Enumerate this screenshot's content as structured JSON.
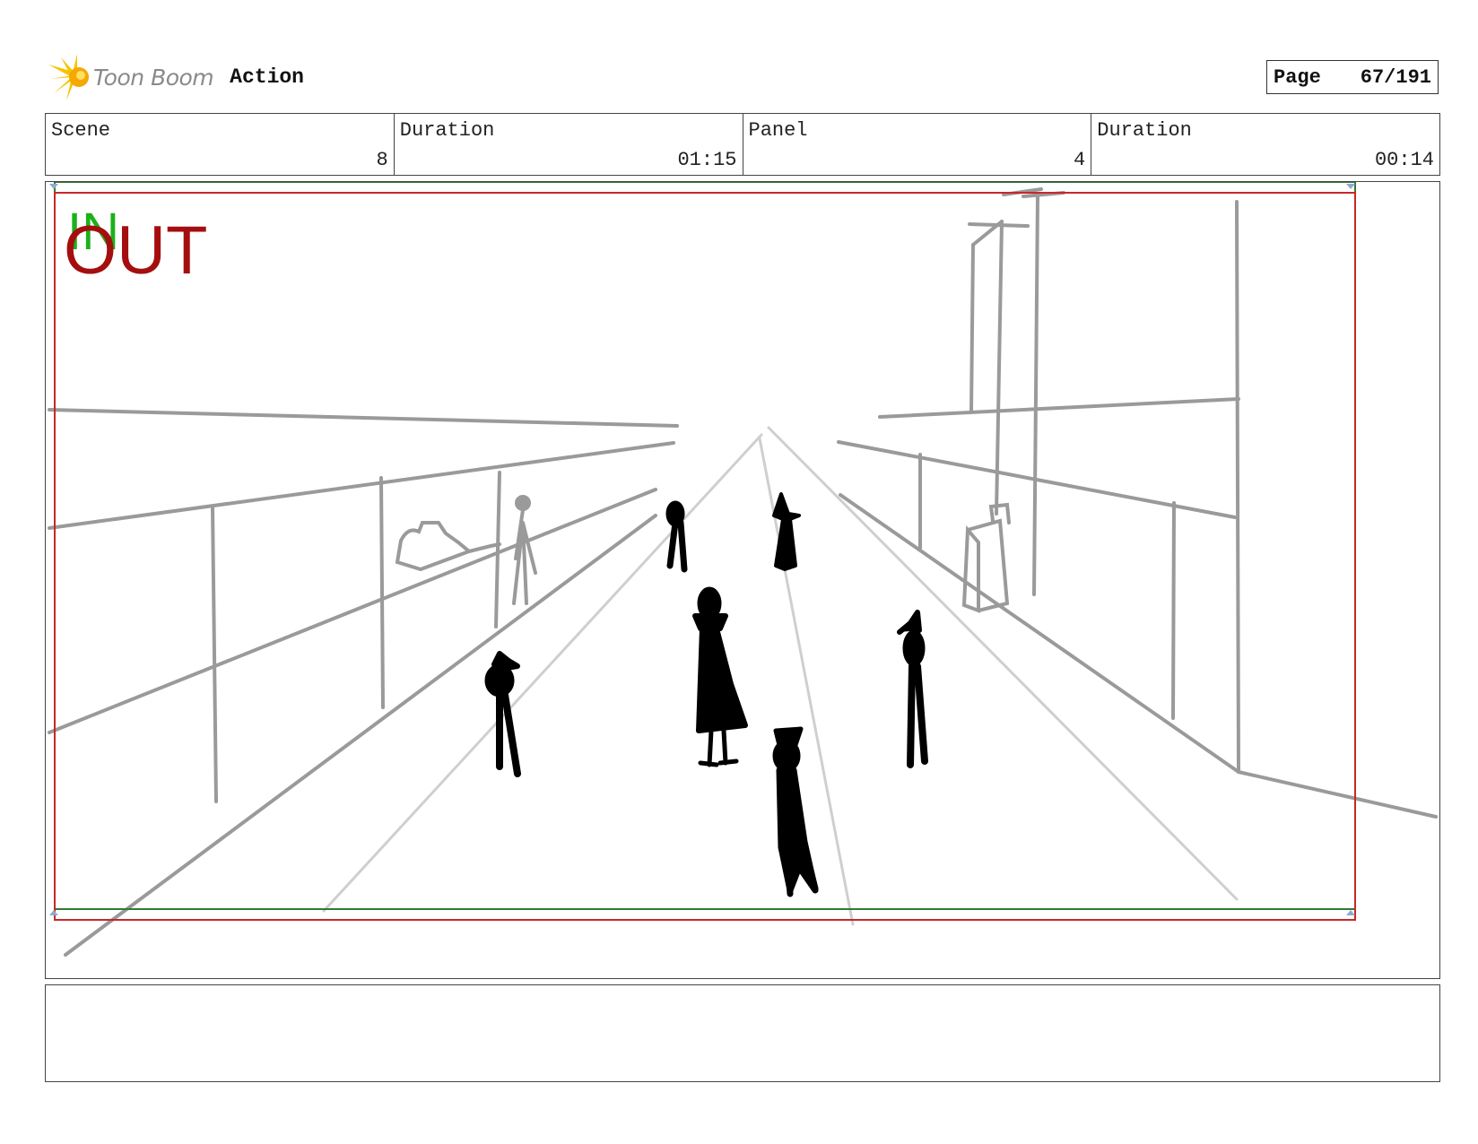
{
  "header": {
    "brand": "Toon Boom",
    "app_name": "Action",
    "page_label": "Page",
    "page_value": "67/191"
  },
  "info": {
    "scene_label": "Scene",
    "scene_value": "8",
    "scene_duration_label": "Duration",
    "scene_duration_value": "01:15",
    "panel_label": "Panel",
    "panel_value": "4",
    "panel_duration_label": "Duration",
    "panel_duration_value": "00:14"
  },
  "panel": {
    "in_label": "IN",
    "out_label": "OUT",
    "in_color": "#1bb11b",
    "out_color": "#a50e0e",
    "in_frame_color": "#2e7d32",
    "out_frame_color": "#c62828"
  },
  "notes": {
    "text": ""
  }
}
